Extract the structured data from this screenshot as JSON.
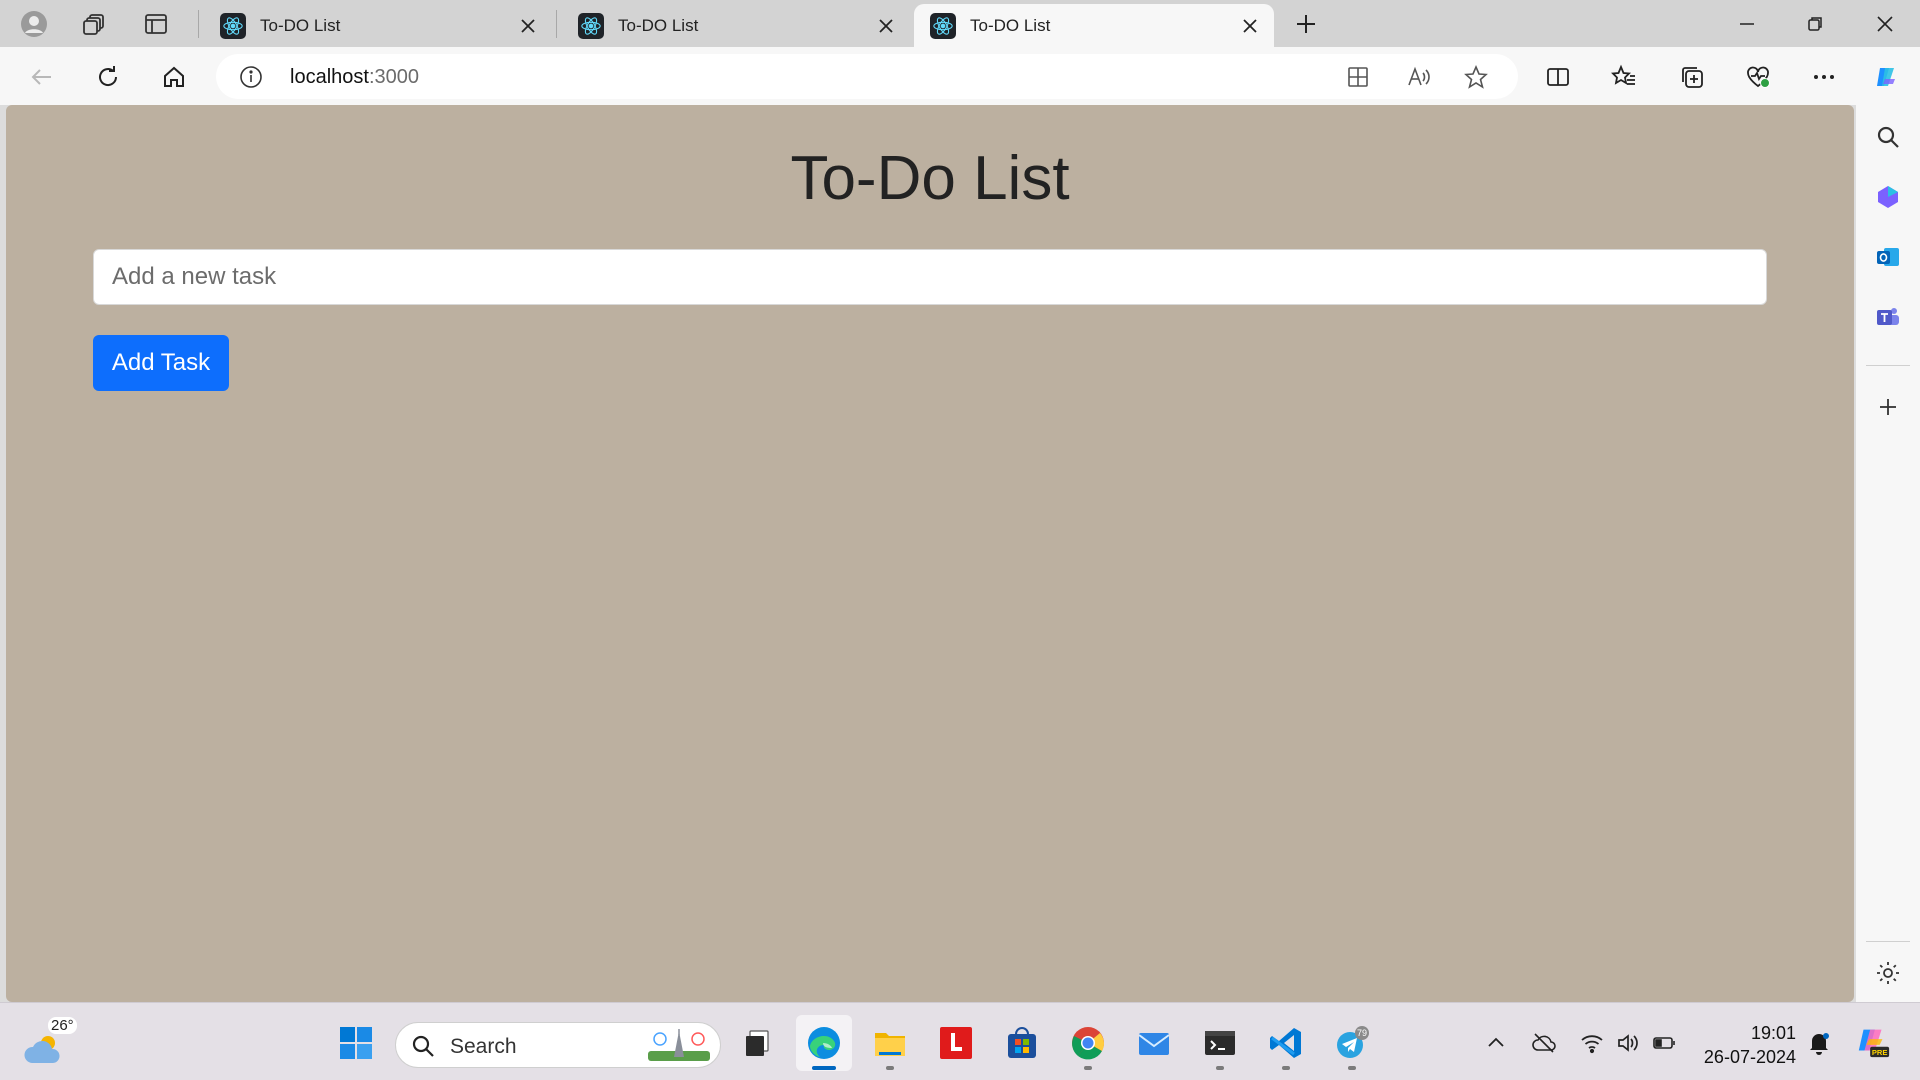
{
  "browser": {
    "tabs": [
      {
        "title": "To-DO List",
        "active": false
      },
      {
        "title": "To-DO List",
        "active": false
      },
      {
        "title": "To-DO List",
        "active": true
      }
    ],
    "address": {
      "host": "localhost",
      "port": ":3000"
    }
  },
  "page": {
    "title": "To-Do List",
    "input_placeholder": "Add a new task",
    "add_button_label": "Add Task",
    "background_color": "#bcb0a0",
    "button_color": "#0d6efd"
  },
  "taskbar": {
    "weather_temp": "26°",
    "search_label": "Search",
    "telegram_badge": "79",
    "time": "19:01",
    "date": "26-07-2024",
    "copilot_badge": "PRE"
  }
}
